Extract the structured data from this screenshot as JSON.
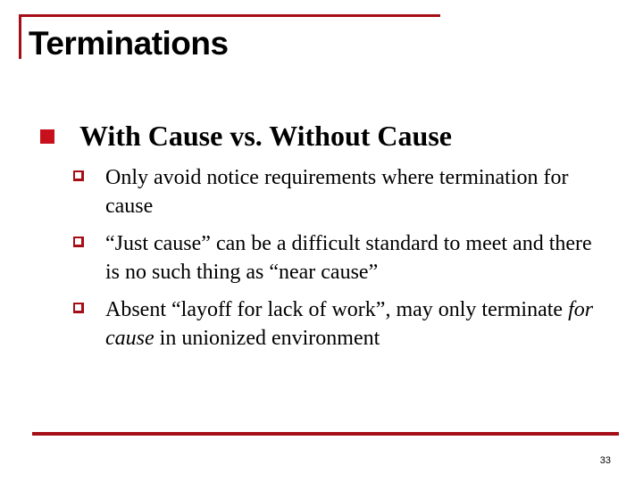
{
  "slide": {
    "title": "Terminations",
    "level1": "With Cause vs. Without Cause",
    "bullets": [
      {
        "text": "Only avoid notice requirements where termination for cause"
      },
      {
        "text": "“Just cause” can be a difficult standard to meet and there is no such thing as “near cause”"
      },
      {
        "pre": "Absent “layoff for lack of work”, may only terminate ",
        "em": "for cause",
        "post": " in unionized environment"
      }
    ],
    "page_number": "33",
    "accent_color": "#a50e16"
  }
}
